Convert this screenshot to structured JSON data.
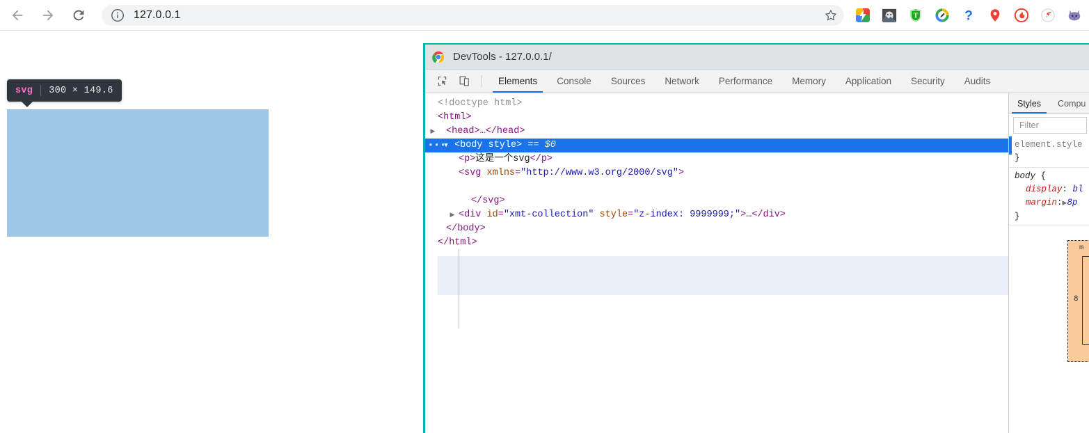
{
  "browser": {
    "back_label": "Back",
    "forward_label": "Forward",
    "reload_label": "Reload",
    "url": "127.0.0.1",
    "info_icon": "info-circle-icon",
    "star_icon": "bookmark-star-icon",
    "extensions": [
      {
        "name": "lightning-colorful-extension",
        "title": "Extension"
      },
      {
        "name": "cat-image-extension",
        "title": "Extension"
      },
      {
        "name": "green-shield-t-extension",
        "title": "Extension"
      },
      {
        "name": "pen-circle-extension",
        "title": "Extension"
      },
      {
        "name": "blue-question-mark-extension",
        "title": "Help"
      },
      {
        "name": "red-location-pin-extension",
        "title": "Location"
      },
      {
        "name": "red-flame-circle-extension",
        "title": "Extension"
      },
      {
        "name": "rocket-circle-extension",
        "title": "Extension"
      },
      {
        "name": "purple-cat-extension",
        "title": "Extension"
      }
    ]
  },
  "inspector": {
    "tooltip_tag": "svg",
    "tooltip_dimensions": "300 × 149.6",
    "highlight_color": "#9fc5e8",
    "tooltip_bg": "#30363d",
    "tag_color": "#ff6ec7"
  },
  "devtools": {
    "title": "DevTools - 127.0.0.1/",
    "chrome_icon": "chrome-logo-icon",
    "border_color": "#00b2b2",
    "accent_color": "#1a73e8",
    "toolbar": {
      "inspect_icon": "inspect-element-icon",
      "device_toggle_icon": "device-toolbar-icon"
    },
    "tabs": [
      {
        "label": "Elements",
        "active": true
      },
      {
        "label": "Console",
        "active": false
      },
      {
        "label": "Sources",
        "active": false
      },
      {
        "label": "Network",
        "active": false
      },
      {
        "label": "Performance",
        "active": false
      },
      {
        "label": "Memory",
        "active": false
      },
      {
        "label": "Application",
        "active": false
      },
      {
        "label": "Security",
        "active": false
      },
      {
        "label": "Audits",
        "active": false
      }
    ],
    "dom": {
      "doctype": "<!doctype html>",
      "html_open": "<html>",
      "head_collapsed": "<head>…</head>",
      "body_open": "<body style>",
      "body_eq": "==",
      "body_dollar": "$0",
      "p_open": "<p>",
      "p_text": "这是一个svg",
      "p_close": "</p>",
      "svg_open_1": "<svg",
      "svg_attr_name": "xmlns",
      "svg_attr_eq": "=",
      "svg_attr_value": "\"http://www.w3.org/2000/svg\"",
      "svg_open_2": ">",
      "svg_close": "</svg>",
      "div_open": "<div",
      "div_attr1_name": "id",
      "div_attr1_value": "\"xmt-collection\"",
      "div_attr2_name": "style",
      "div_attr2_value": "\"z-index: 9999999;\"",
      "div_gt": ">",
      "div_ellipsis": "…",
      "div_close": "</div>",
      "body_close": "</body>",
      "html_close": "</html>"
    },
    "styles": {
      "tabs": [
        {
          "label": "Styles",
          "active": true
        },
        {
          "label": "Compu",
          "active": false
        }
      ],
      "filter_placeholder": "Filter",
      "rules": [
        {
          "selector": "element.style",
          "open_brace": "{",
          "close_brace": "}",
          "declarations": []
        },
        {
          "selector": "body",
          "open_brace": "{",
          "close_brace": "}",
          "declarations": [
            {
              "property": "display",
              "value": "bl"
            },
            {
              "property": "margin",
              "value": "8p",
              "has_arrow": true
            }
          ]
        }
      ]
    },
    "box_model": {
      "label": "m",
      "value": "8",
      "fill_color": "#f9cb9c"
    },
    "spinner": {
      "name": "loading-spinner",
      "color": "#1a8cff"
    },
    "cursor": {
      "name": "mouse-cursor"
    }
  }
}
